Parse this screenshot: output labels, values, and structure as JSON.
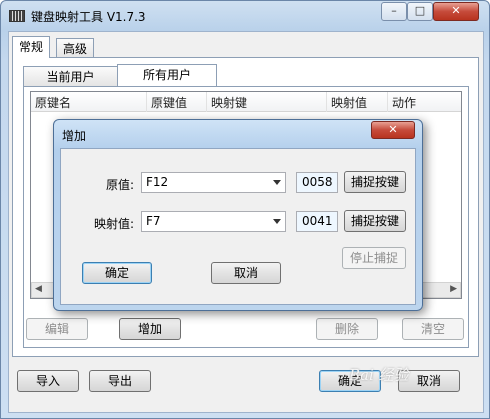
{
  "window": {
    "title": "键盘映射工具 V1.7.3",
    "min": "–",
    "max": "□",
    "close": "✕"
  },
  "outer_tabs": [
    "常规",
    "高级"
  ],
  "inner_tabs": [
    "当前用户",
    "所有用户"
  ],
  "table_headers": [
    "原键名",
    "原键值",
    "映射键",
    "映射值",
    "动作"
  ],
  "list_buttons": {
    "edit": "编辑",
    "add": "增加",
    "delete": "删除",
    "clear": "清空"
  },
  "bottom_buttons": {
    "import": "导入",
    "export": "导出",
    "ok": "确定",
    "cancel": "取消"
  },
  "dialog": {
    "title": "增加",
    "close": "✕",
    "source_label": "原值:",
    "source_value": "F12",
    "source_code": "0058",
    "capture_label": "捕捉按键",
    "map_label": "映射值:",
    "map_value": "F7",
    "map_code": "0041",
    "stop_capture_label": "停止捕捉",
    "ok_label": "确定",
    "cancel_label": "取消"
  },
  "watermark": "Bai 经验"
}
